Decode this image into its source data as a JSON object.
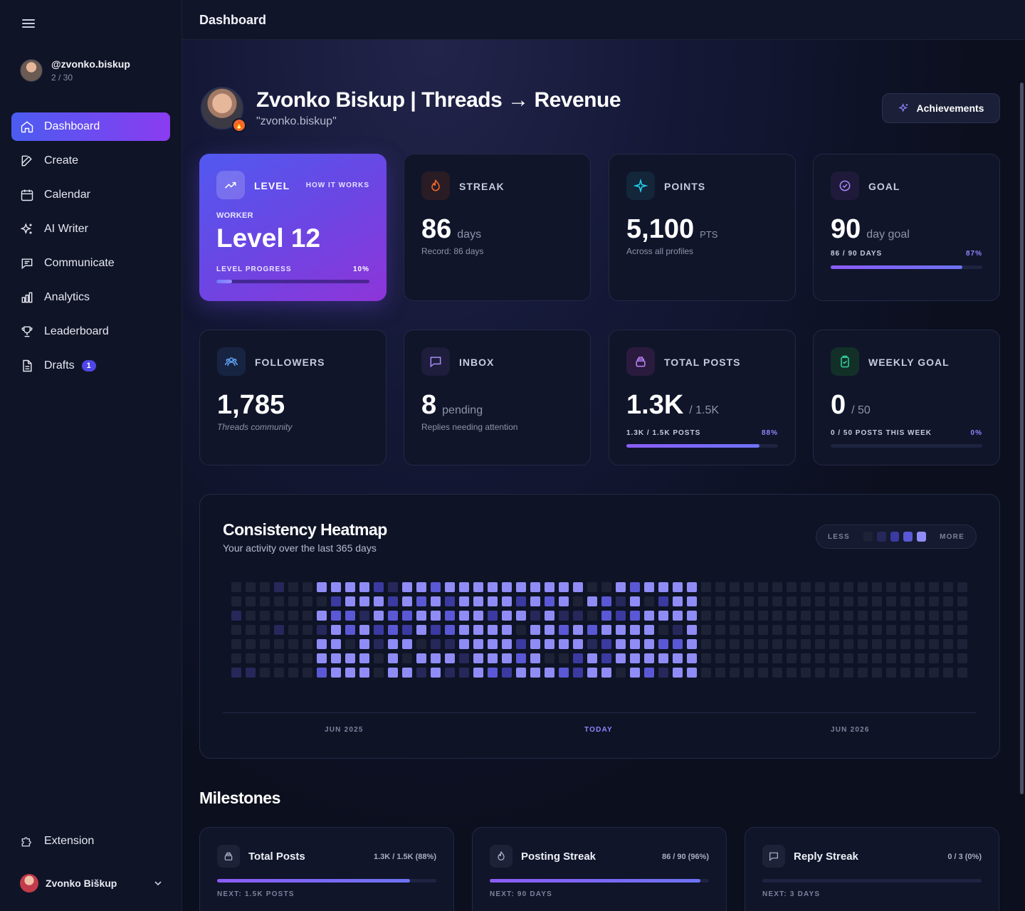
{
  "sidebar": {
    "profile": {
      "handle": "@zvonko.biskup",
      "count": "2 / 30"
    },
    "nav": [
      {
        "label": "Dashboard",
        "icon": "home-icon",
        "active": true
      },
      {
        "label": "Create",
        "icon": "edit-icon"
      },
      {
        "label": "Calendar",
        "icon": "calendar-icon"
      },
      {
        "label": "AI Writer",
        "icon": "sparkles-icon"
      },
      {
        "label": "Communicate",
        "icon": "chat-icon"
      },
      {
        "label": "Analytics",
        "icon": "bar-chart-icon"
      },
      {
        "label": "Leaderboard",
        "icon": "trophy-icon"
      },
      {
        "label": "Drafts",
        "icon": "file-icon",
        "badge": "1"
      }
    ],
    "extension": "Extension",
    "user_name": "Zvonko Biškup"
  },
  "topbar": {
    "title": "Dashboard"
  },
  "header": {
    "title": "Zvonko Biskup | Threads → Revenue",
    "subtitle": "\"zvonko.biskup\"",
    "achievements_label": "Achievements"
  },
  "cards": {
    "level": {
      "label": "LEVEL",
      "how": "HOW IT WORKS",
      "role": "WORKER",
      "value": "Level 12",
      "progress_label": "LEVEL PROGRESS",
      "progress_pct": "10%",
      "progress": 0.1
    },
    "streak": {
      "label": "STREAK",
      "value": "86",
      "unit": "days",
      "note": "Record: 86 days"
    },
    "points": {
      "label": "POINTS",
      "value": "5,100",
      "unit": "PTS",
      "note": "Across all profiles"
    },
    "goal": {
      "label": "GOAL",
      "value": "90",
      "unit": "day goal",
      "progress_label": "86 / 90 DAYS",
      "progress_pct": "87%",
      "progress": 0.87
    },
    "followers": {
      "label": "FOLLOWERS",
      "value": "1,785",
      "note": "Threads community"
    },
    "inbox": {
      "label": "INBOX",
      "value": "8",
      "unit": "pending",
      "note": "Replies needing attention"
    },
    "total_posts": {
      "label": "TOTAL POSTS",
      "value": "1.3K",
      "unit": "/ 1.5K",
      "progress_label": "1.3K / 1.5K POSTS",
      "progress_pct": "88%",
      "progress": 0.88
    },
    "weekly_goal": {
      "label": "WEEKLY GOAL",
      "value": "0",
      "unit": "/ 50",
      "progress_label": "0 / 50 POSTS THIS WEEK",
      "progress_pct": "0%",
      "progress": 0.0
    }
  },
  "heatmap": {
    "title": "Consistency Heatmap",
    "subtitle": "Your activity over the last 365 days",
    "legend_less": "LESS",
    "legend_more": "MORE",
    "legend_colors": [
      "#1e2236",
      "#26285a",
      "#3b3aa0",
      "#5a58d4",
      "#8f8cf6"
    ],
    "x_labels": {
      "left": "JUN 2025",
      "center": "TODAY",
      "right": "JUN 2026"
    }
  },
  "milestones": {
    "title": "Milestones",
    "items": [
      {
        "title": "Total Posts",
        "value": "1.3K / 1.5K (88%)",
        "next": "NEXT: 1.5K POSTS",
        "progress": 0.88,
        "icon": "stack-icon"
      },
      {
        "title": "Posting Streak",
        "value": "86 / 90 (96%)",
        "next": "NEXT: 90 DAYS",
        "progress": 0.96,
        "icon": "flame-icon"
      },
      {
        "title": "Reply Streak",
        "value": "0 / 3 (0%)",
        "next": "NEXT: 3 DAYS",
        "progress": 0.0,
        "icon": "chat-icon"
      }
    ]
  }
}
